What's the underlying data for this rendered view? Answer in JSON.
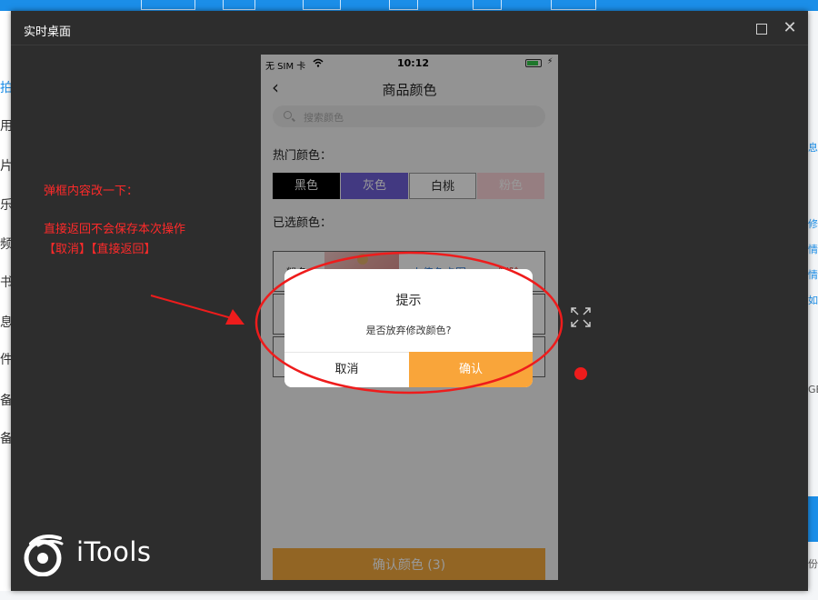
{
  "window": {
    "title": "实时桌面",
    "logo_text": "iTools"
  },
  "background_app": {
    "left_fragments": [
      "拍",
      "用",
      "片",
      "乐",
      "频",
      "书",
      "息",
      "件",
      "备",
      "备"
    ],
    "right_fragments": [
      "息",
      "修",
      "情",
      "情",
      "如",
      "GB",
      "份"
    ]
  },
  "annotation": {
    "line1": "弹框内容改一下：",
    "line2": "直接返回不会保存本次操作",
    "line3": "【取消】【直接返回】",
    "color": "#ff2a2a"
  },
  "phone": {
    "status_bar": {
      "carrier": "无 SIM 卡",
      "time": "10:12"
    },
    "nav": {
      "title": "商品颜色"
    },
    "search": {
      "placeholder": "搜索颜色"
    },
    "hot_colors_label": "热门颜色：",
    "hot_colors": [
      {
        "label": "黑色",
        "bg": "#000000",
        "fg": "#ffffff"
      },
      {
        "label": "灰色",
        "bg": "#6f5fd8",
        "fg": "#ffffff"
      },
      {
        "label": "白桃",
        "bg": "#ffffff",
        "fg": "#333333"
      },
      {
        "label": "粉色",
        "bg": "#fbd2d8",
        "fg": "#ffffff"
      }
    ],
    "selected_label": "已选颜色：",
    "selected": [
      {
        "name": "粉色",
        "upload": "上传色卡图",
        "delete": "删除"
      }
    ],
    "confirm_button": "确认颜色 (3)",
    "dialog": {
      "title": "提示",
      "message": "是否放弃修改颜色?",
      "cancel": "取消",
      "ok": "确认",
      "ok_color": "#f9a53a"
    }
  }
}
